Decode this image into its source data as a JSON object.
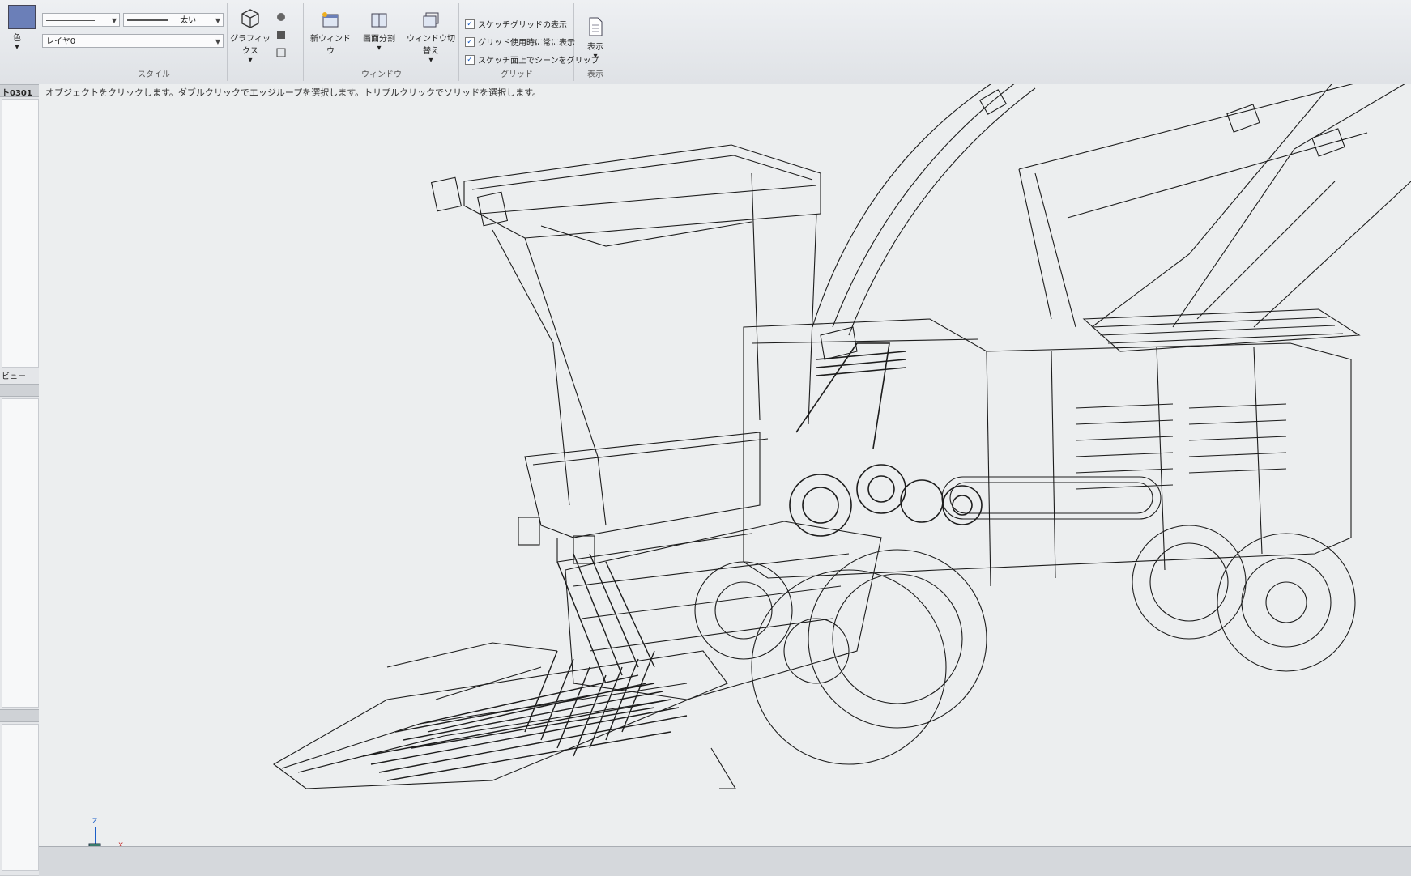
{
  "ribbon": {
    "style_group": {
      "label": "スタイル",
      "color_label": "色",
      "line_weight_label": "太い",
      "layer_label": "レイヤ0"
    },
    "graphics_label": "グラフィックス",
    "window_group": {
      "label": "ウィンドウ",
      "new_window_label": "新ウィンドウ",
      "split_label": "画面分割",
      "switch_label": "ウィンドウ切替え"
    },
    "grid_group": {
      "label": "グリッド",
      "options": [
        {
          "label": "スケッチグリッドの表示",
          "checked": true
        },
        {
          "label": "グリッド使用時に常に表示",
          "checked": true
        },
        {
          "label": "スケッチ面上でシーンをグリップ",
          "checked": true
        }
      ]
    },
    "display_group": {
      "label": "表示",
      "display_button_label": "表示"
    }
  },
  "left_panel": {
    "tab_label": "ト0301",
    "view_label": "ビュー"
  },
  "status_message": "オブジェクトをクリックします。ダブルクリックでエッジループを選択します。トリプルクリックでソリッドを選択します。",
  "axis": {
    "z": "Z",
    "x": "X"
  },
  "colors": {
    "line": "#1a1a1a",
    "background": "#eceeef",
    "accent": "#1a5ec8"
  }
}
